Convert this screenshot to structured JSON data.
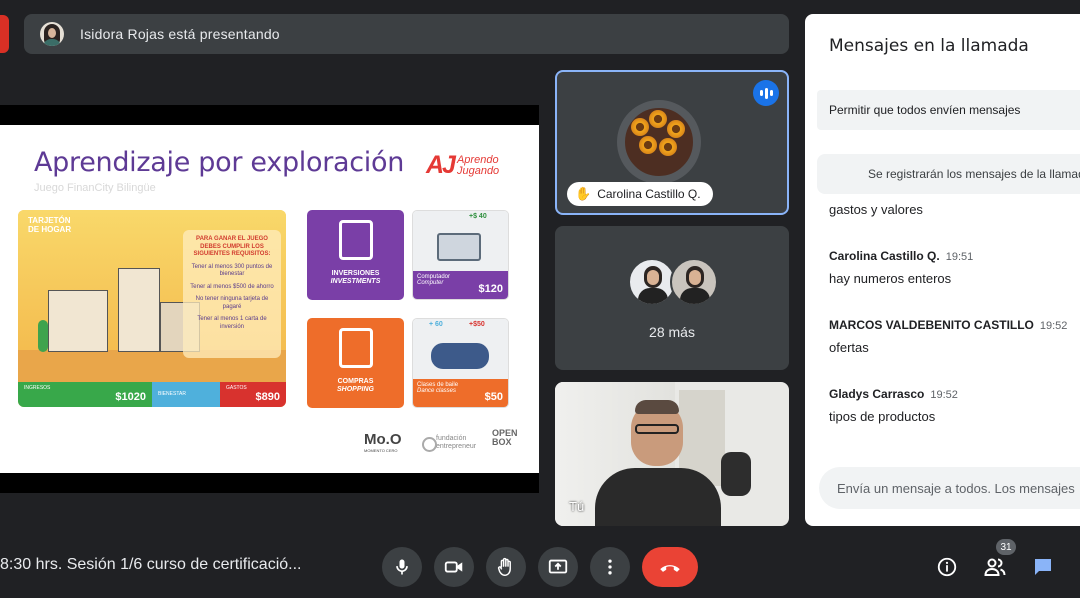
{
  "presenter": {
    "text": "Isidora Rojas está presentando"
  },
  "slide": {
    "title": "Aprendizaje por exploración",
    "subtitle": "Juego FinanCity Bilingüe",
    "logo_mark": "AJ",
    "logo_word_1": "Aprendo",
    "logo_word_2": "Jugando",
    "tarjeton": {
      "tag_1": "TARJETÓN",
      "tag_2": "DE HOGAR",
      "rules_head": "PARA GANAR EL JUEGO DEBES CUMPLIR LOS SIGUIENTES REQUISITOS:",
      "rules": [
        "Tener al menos 300 puntos de bienestar",
        "Tener al menos $500 de ahorro",
        "No tener ninguna tarjeta de pagaré",
        "Tener al menos 1 carta de inversión"
      ],
      "ingresos_label": "INGRESOS",
      "ingresos_value": "$1020",
      "bienestar_label": "BIENESTAR",
      "gastos_label": "GASTOS",
      "gastos_value": "$890"
    },
    "cards": {
      "inversiones": "INVERSIONES",
      "investments": "INVESTMENTS",
      "compras": "COMPRAS",
      "shopping": "SHOPPING",
      "pc_badge": "+$ 40",
      "pc_name": "Computador",
      "pc_name_en": "Computer",
      "pc_price": "$120",
      "bat_badge_1": "+ 60",
      "bat_badge_2": "+$50",
      "bat_name": "Clases de baile",
      "bat_name_en": "Dance classes",
      "bat_price": "$50"
    },
    "logo_mo": "Mo.O",
    "logo_mo_sub": "MOMENTO CERO",
    "logo_fe_1": "fundación",
    "logo_fe_2": "entrepreneur",
    "logo_ob_1": "OPEN",
    "logo_ob_2": "BOX"
  },
  "tiles": {
    "carolina": "Carolina Castillo Q.",
    "more": "28 más",
    "self": "Tú"
  },
  "chat": {
    "title": "Mensajes en la llamada",
    "allow": "Permitir que todos envíen mensajes",
    "notice": "Se registrarán los mensajes de la llamada",
    "fragment": "gastos y valores",
    "messages": [
      {
        "author": "Carolina Castillo Q.",
        "time": "19:51",
        "text": "hay numeros enteros"
      },
      {
        "author": "MARCOS VALDEBENITO CASTILLO",
        "time": "19:52",
        "text": "ofertas"
      },
      {
        "author": "Gladys Carrasco",
        "time": "19:52",
        "text": "tipos de productos"
      }
    ],
    "input_placeholder": "Envía un mensaje a todos. Los mensajes"
  },
  "bottom": {
    "meeting_title": "8:30 hrs. Sesión 1/6 curso de certificació...",
    "people_count": "31"
  },
  "colors": {
    "background": "#202124",
    "tile": "#3c4043",
    "leave": "#ea4335",
    "accent": "#1a73e8",
    "speaking_border": "#8ab4f8"
  },
  "icons": {
    "mic": "mic-icon",
    "camera": "camera-icon",
    "hand": "raise-hand-icon",
    "present": "present-screen-icon",
    "more": "more-vert-icon",
    "leave": "call-end-icon",
    "info": "info-icon",
    "people": "people-icon",
    "chat": "chat-icon"
  }
}
